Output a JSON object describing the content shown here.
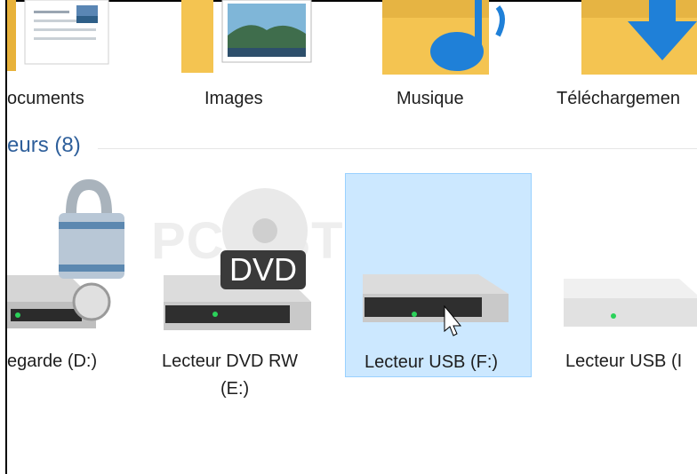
{
  "folders": [
    {
      "label": "ocuments",
      "icon": "documents-folder-icon"
    },
    {
      "label": "Images",
      "icon": "images-folder-icon"
    },
    {
      "label": "Musique",
      "icon": "music-folder-icon"
    },
    {
      "label": "Téléchargemen",
      "icon": "downloads-folder-icon"
    }
  ],
  "section": {
    "title": "eurs (8)"
  },
  "drives": [
    {
      "label": "egarde (D:)",
      "icon": "locked-drive-icon"
    },
    {
      "label_line1": "Lecteur DVD RW",
      "label_line2": "(E:)",
      "badge": "DVD",
      "icon": "dvd-drive-icon"
    },
    {
      "label": "Lecteur USB (F:)",
      "icon": "usb-drive-icon",
      "selected": true
    },
    {
      "label": "Lecteur USB (I",
      "icon": "usb-drive-icon"
    }
  ],
  "watermark": "PC ASTUCES",
  "colors": {
    "selection": "#cce8ff",
    "selection_border": "#99d1ff",
    "section_title": "#2e5f9b",
    "folder": "#f4c451",
    "drive_led": "#2bd25a"
  }
}
